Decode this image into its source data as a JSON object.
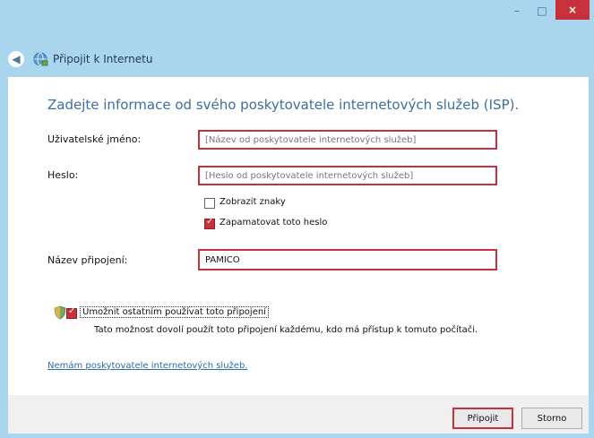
{
  "window": {
    "close_glyph": "×",
    "minimize_glyph": "–",
    "maximize_glyph": "□"
  },
  "nav": {
    "title": "Připojit k Internetu"
  },
  "heading": "Zadejte informace od svého poskytovatele internetových služeb (ISP).",
  "form": {
    "username": {
      "label": "Uživatelské jméno:",
      "placeholder": "[Název od poskytovatele internetových služeb]",
      "value": ""
    },
    "password": {
      "label": "Heslo:",
      "placeholder": "[Heslo od poskytovatele internetových služeb]",
      "value": ""
    },
    "show_chars": {
      "label": "Zobrazit znaky",
      "checked": false
    },
    "remember": {
      "label": "Zapamatovat toto heslo",
      "checked": true
    },
    "connection_name": {
      "label": "Název připojení:",
      "value": "PAMICO"
    }
  },
  "allow_others": {
    "label": "Umožnit ostatním používat toto připojení",
    "checked": true,
    "description": "Tato možnost dovolí použít toto připojení každému, kdo má přístup k tomuto počítači."
  },
  "link": "Nemám poskytovatele internetových služeb.",
  "buttons": {
    "connect": "Připojit",
    "cancel": "Storno"
  },
  "colors": {
    "accent_red": "#c8303b",
    "window_bg": "#a9d6ee",
    "heading": "#3d6f9e",
    "link": "#2a6ea8"
  }
}
